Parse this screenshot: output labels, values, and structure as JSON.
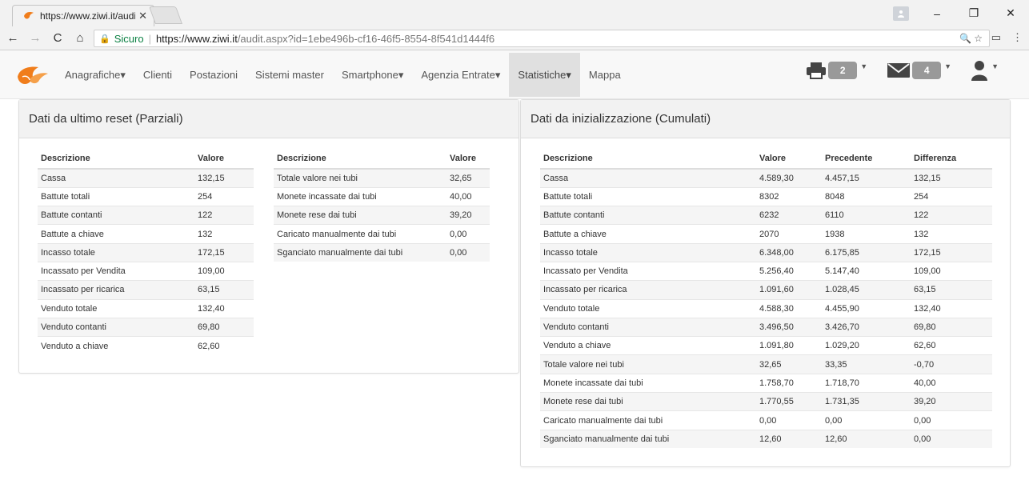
{
  "browser": {
    "tab_title": "https://www.ziwi.it/audit",
    "address": {
      "secure_label": "Sicuro",
      "url_scheme_host": "https://www.ziwi.it",
      "url_path": "/audit.aspx?id=1ebe496b-cf16-46f5-8554-8f541d1444f6"
    }
  },
  "navbar": {
    "items": [
      {
        "label": "Anagrafiche",
        "dropdown": true
      },
      {
        "label": "Clienti",
        "dropdown": false
      },
      {
        "label": "Postazioni",
        "dropdown": false
      },
      {
        "label": "Sistemi master",
        "dropdown": false
      },
      {
        "label": "Smartphone",
        "dropdown": true
      },
      {
        "label": "Agenzia Entrate",
        "dropdown": true
      },
      {
        "label": "Statistiche",
        "dropdown": true,
        "active": true
      },
      {
        "label": "Mappa",
        "dropdown": false
      }
    ],
    "print_count": "2",
    "mail_count": "4",
    "accent_color": "#f07d1b"
  },
  "left_panel": {
    "title": "Dati da ultimo reset (Parziali)",
    "table_a": {
      "headers": [
        "Descrizione",
        "Valore"
      ],
      "rows": [
        [
          "Cassa",
          "132,15"
        ],
        [
          "Battute totali",
          "254"
        ],
        [
          "Battute contanti",
          "122"
        ],
        [
          "Battute a chiave",
          "132"
        ],
        [
          "Incasso totale",
          "172,15"
        ],
        [
          "Incassato per Vendita",
          "109,00"
        ],
        [
          "Incassato per ricarica",
          "63,15"
        ],
        [
          "Venduto totale",
          "132,40"
        ],
        [
          "Venduto contanti",
          "69,80"
        ],
        [
          "Venduto a chiave",
          "62,60"
        ]
      ]
    },
    "table_b": {
      "headers": [
        "Descrizione",
        "Valore"
      ],
      "rows": [
        [
          "Totale valore nei tubi",
          "32,65"
        ],
        [
          "Monete incassate dai tubi",
          "40,00"
        ],
        [
          "Monete rese dai tubi",
          "39,20"
        ],
        [
          "Caricato manualmente dai tubi",
          "0,00"
        ],
        [
          "Sganciato manualmente dai tubi",
          "0,00"
        ]
      ]
    }
  },
  "right_panel": {
    "title": "Dati da inizializzazione (Cumulati)",
    "table": {
      "headers": [
        "Descrizione",
        "Valore",
        "Precedente",
        "Differenza"
      ],
      "rows": [
        [
          "Cassa",
          "4.589,30",
          "4.457,15",
          "132,15"
        ],
        [
          "Battute totali",
          "8302",
          "8048",
          "254"
        ],
        [
          "Battute contanti",
          "6232",
          "6110",
          "122"
        ],
        [
          "Battute a chiave",
          "2070",
          "1938",
          "132"
        ],
        [
          "Incasso totale",
          "6.348,00",
          "6.175,85",
          "172,15"
        ],
        [
          "Incassato per Vendita",
          "5.256,40",
          "5.147,40",
          "109,00"
        ],
        [
          "Incassato per ricarica",
          "1.091,60",
          "1.028,45",
          "63,15"
        ],
        [
          "Venduto totale",
          "4.588,30",
          "4.455,90",
          "132,40"
        ],
        [
          "Venduto contanti",
          "3.496,50",
          "3.426,70",
          "69,80"
        ],
        [
          "Venduto a chiave",
          "1.091,80",
          "1.029,20",
          "62,60"
        ],
        [
          "Totale valore nei tubi",
          "32,65",
          "33,35",
          "-0,70"
        ],
        [
          "Monete incassate dai tubi",
          "1.758,70",
          "1.718,70",
          "40,00"
        ],
        [
          "Monete rese dai tubi",
          "1.770,55",
          "1.731,35",
          "39,20"
        ],
        [
          "Caricato manualmente dai tubi",
          "0,00",
          "0,00",
          "0,00"
        ],
        [
          "Sganciato manualmente dai tubi",
          "12,60",
          "12,60",
          "0,00"
        ]
      ]
    }
  }
}
